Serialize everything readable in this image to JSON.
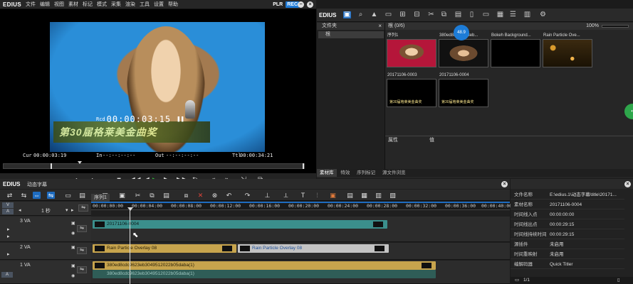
{
  "player": {
    "logo": "EDIUS",
    "menu": [
      "文件",
      "编辑",
      "视图",
      "素材",
      "标记",
      "模式",
      "采集",
      "渲染",
      "工具",
      "设置",
      "帮助"
    ],
    "plr": "PLR",
    "rec": "REC",
    "overlay_label": "Rcd",
    "overlay_tc": "00:00:03:15",
    "subtitle": "第30届格莱美金曲奖",
    "cur_label": "Cur",
    "cur_tc": "00:00:03:19",
    "in_label": "In",
    "in_tc": "--:--:--:--",
    "out_label": "Out",
    "out_tc": "--:--:--:--",
    "ttl_label": "Ttl",
    "ttl_tc": "00:00:34:21"
  },
  "bin": {
    "logo": "EDIUS",
    "folder_header": "文件夹",
    "folder_item": "根",
    "bin_path": "根 (0/6)",
    "zoom": "100%",
    "clips": [
      {
        "name": "序列1",
        "kind": "face"
      },
      {
        "name": "380ed8cdc9623eb...",
        "kind": "face2"
      },
      {
        "name": "Bokeh Background...",
        "kind": "black"
      },
      {
        "name": "Rain Particle Ove...",
        "kind": "rain"
      },
      {
        "name": "20171106-0003",
        "kind": "title"
      },
      {
        "name": "20171106-0004",
        "kind": "title"
      }
    ],
    "title_thumb_text": "第30届格莱美金曲奖",
    "props_col1": "属性",
    "props_col2": "值",
    "tabs": [
      "素材库",
      "特效",
      "序列标记",
      "源文件浏览"
    ],
    "badge": "48.9"
  },
  "timeline": {
    "logo": "EDIUS",
    "project": "动态字幕",
    "seq_tab": "序列1",
    "scale": "1 秒",
    "ruler": [
      "00:00:00:00",
      "00:00:04:00",
      "00:00:08:00",
      "00:00:12:00",
      "00:00:16:00",
      "00:00:20:00",
      "00:00:24:00",
      "00:00:28:00",
      "00:00:32:00",
      "00:00:36:00",
      "00:00:40:00"
    ],
    "tracks": [
      {
        "name": "3 VA",
        "clips": [
          {
            "label": "20171106-0004"
          }
        ]
      },
      {
        "name": "2 VA",
        "clips": [
          {
            "label": "Rain Particle Overlay 08"
          },
          {
            "label": "Rain Particle Overlay 08"
          }
        ]
      },
      {
        "name": "1 VA",
        "clips": [
          {
            "label": "380ed8cdc9623eb3049512022b05daba(1)"
          },
          {
            "label": "380ed8cdc9623eb3049512022b05daba(1)"
          }
        ]
      }
    ]
  },
  "info": {
    "rows": [
      {
        "k": "文件名称",
        "v": "E:\\edius.1\\动态字幕\\title\\20171..."
      },
      {
        "k": "素材名称",
        "v": "20171106-0004"
      },
      {
        "k": "时间线入点",
        "v": "00:00:00:00"
      },
      {
        "k": "时间线出点",
        "v": "00:00:29:15"
      },
      {
        "k": "时间线持续时间",
        "v": "00:00:29:15"
      },
      {
        "k": "源插件",
        "v": "未启用"
      },
      {
        "k": "时间重映射",
        "v": "未启用"
      },
      {
        "k": "编解码器",
        "v": "Quick Titler"
      }
    ],
    "footer": "1/1"
  }
}
